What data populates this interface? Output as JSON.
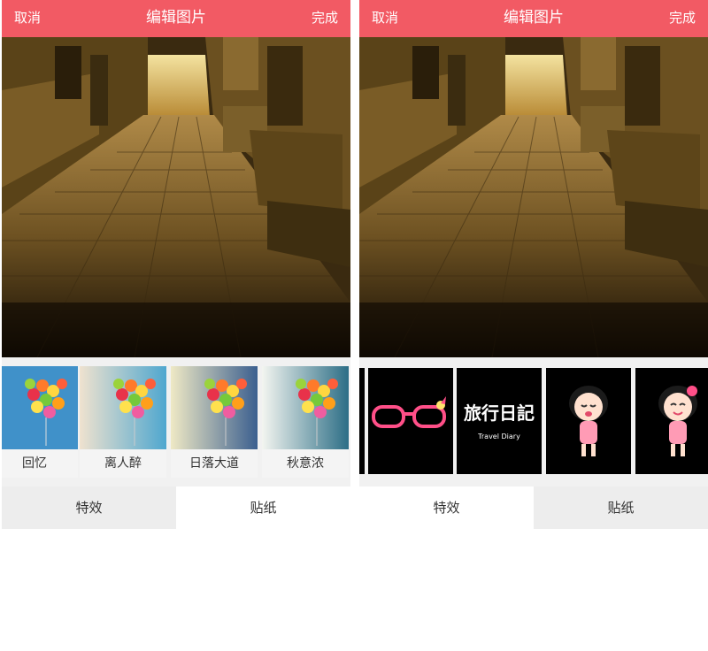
{
  "screens": [
    {
      "header": {
        "cancel_label": "取消",
        "title": "编辑图片",
        "done_label": "完成"
      },
      "effects": [
        {
          "label": "回忆"
        },
        {
          "label": "离人醉"
        },
        {
          "label": "日落大道"
        },
        {
          "label": "秋意浓"
        }
      ],
      "tabs": [
        {
          "label": "特效",
          "active": true
        },
        {
          "label": "贴纸",
          "active": false
        }
      ]
    },
    {
      "header": {
        "cancel_label": "取消",
        "title": "编辑图片",
        "done_label": "完成"
      },
      "stickers": [
        {
          "icon": "glasses-sticker-icon"
        },
        {
          "icon": "travel-diary-sticker-icon",
          "text_main": "旅行日記",
          "text_en": "Travel Diary"
        },
        {
          "icon": "crying-girl-sticker-icon"
        },
        {
          "icon": "happy-girl-sticker-icon"
        }
      ],
      "tabs": [
        {
          "label": "特效",
          "active": false
        },
        {
          "label": "贴纸",
          "active": true
        }
      ]
    }
  ],
  "colors": {
    "accent": "#f25a64",
    "tab_inactive": "#ededed",
    "tab_active": "#ffffff"
  }
}
